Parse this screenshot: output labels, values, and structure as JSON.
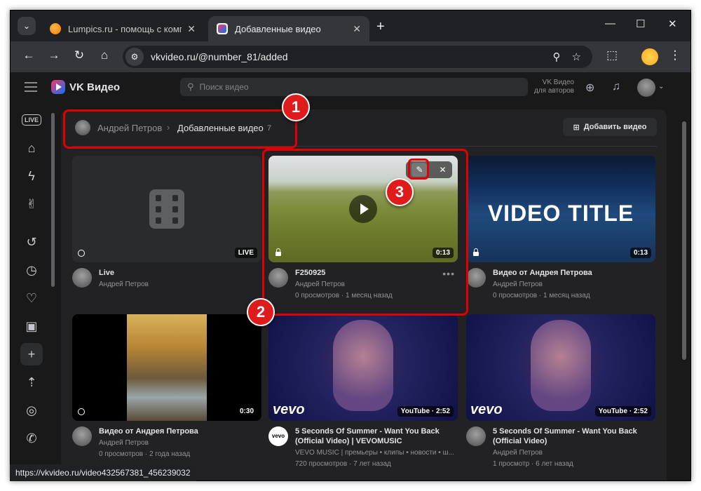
{
  "browser": {
    "tabs": [
      {
        "title": "Lumpics.ru - помощь с компь",
        "active": false
      },
      {
        "title": "Добавленные видео",
        "active": true
      }
    ],
    "url": "vkvideo.ru/@number_81/added",
    "status_url": "https://vkvideo.ru/video432567381_456239032"
  },
  "vk": {
    "brand": "VK Видео",
    "search_placeholder": "Поиск видео",
    "authors_line1": "VK Видео",
    "authors_line2": "для авторов"
  },
  "breadcrumb": {
    "user": "Андрей Петров",
    "page": "Добавленные видео",
    "count": "7"
  },
  "add_video_label": "Добавить видео",
  "videos": [
    {
      "title": "Live",
      "author": "Андрей Петров",
      "stats": "",
      "badge": "LIVE"
    },
    {
      "title": "F250925",
      "author": "Андрей Петров",
      "stats": "0 просмотров · 1 месяц назад",
      "badge": "0:13"
    },
    {
      "title": "Видео от Андрея Петрова",
      "author": "Андрей Петров",
      "stats": "0 просмотров · 1 месяц назад",
      "badge": "0:13",
      "thumb_text": "VIDEO TITLE"
    },
    {
      "title": "Видео от Андрея Петрова",
      "author": "Андрей Петров",
      "stats": "0 просмотров · 2 года назад",
      "badge": "0:30"
    },
    {
      "title": "5 Seconds Of Summer - Want You Back (Official Video) | VEVOMUSIC",
      "author": "VEVO MUSIC | премьеры • клипы • новости • ш...",
      "stats": "720 просмотров · 7 лет назад",
      "badge": "YouTube · 2:52",
      "logo": "vevo"
    },
    {
      "title": "5 Seconds Of Summer - Want You Back (Official Video)",
      "author": "Андрей Петров",
      "stats": "1 просмотр · 6 лет назад",
      "badge": "YouTube · 2:52",
      "logo": "vevo"
    }
  ],
  "annotations": [
    "1",
    "2",
    "3"
  ],
  "colors": {
    "accent": "#e00000",
    "background": "#19191a",
    "panel": "#222224"
  }
}
